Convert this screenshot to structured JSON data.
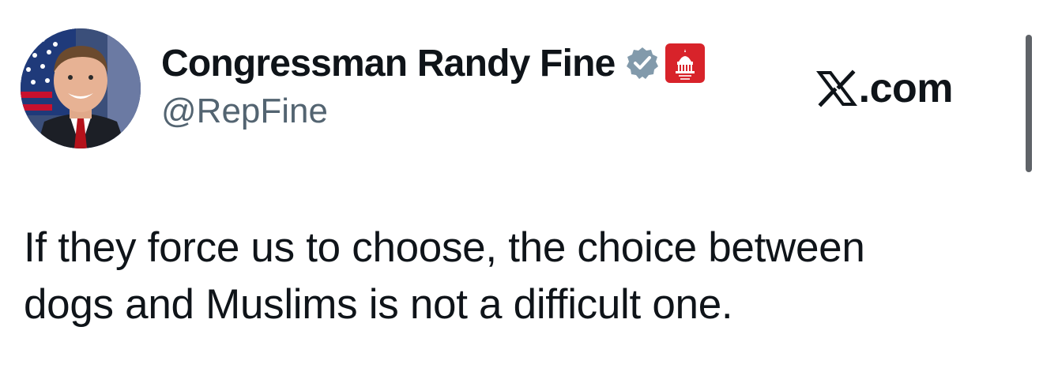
{
  "author": {
    "display_name": "Congressman Randy Fine",
    "handle": "@RepFine",
    "verified_badge": "verified-icon",
    "affiliate_badge": "house-gop-badge",
    "verified_color": "#829aab",
    "affiliate_color": "#d8232a"
  },
  "site": {
    "label": ".com",
    "logo": "x-logo-icon"
  },
  "tweet": {
    "lines": [
      "If they force us to choose, the choice between",
      "dogs and Muslims is not a difficult one."
    ]
  }
}
